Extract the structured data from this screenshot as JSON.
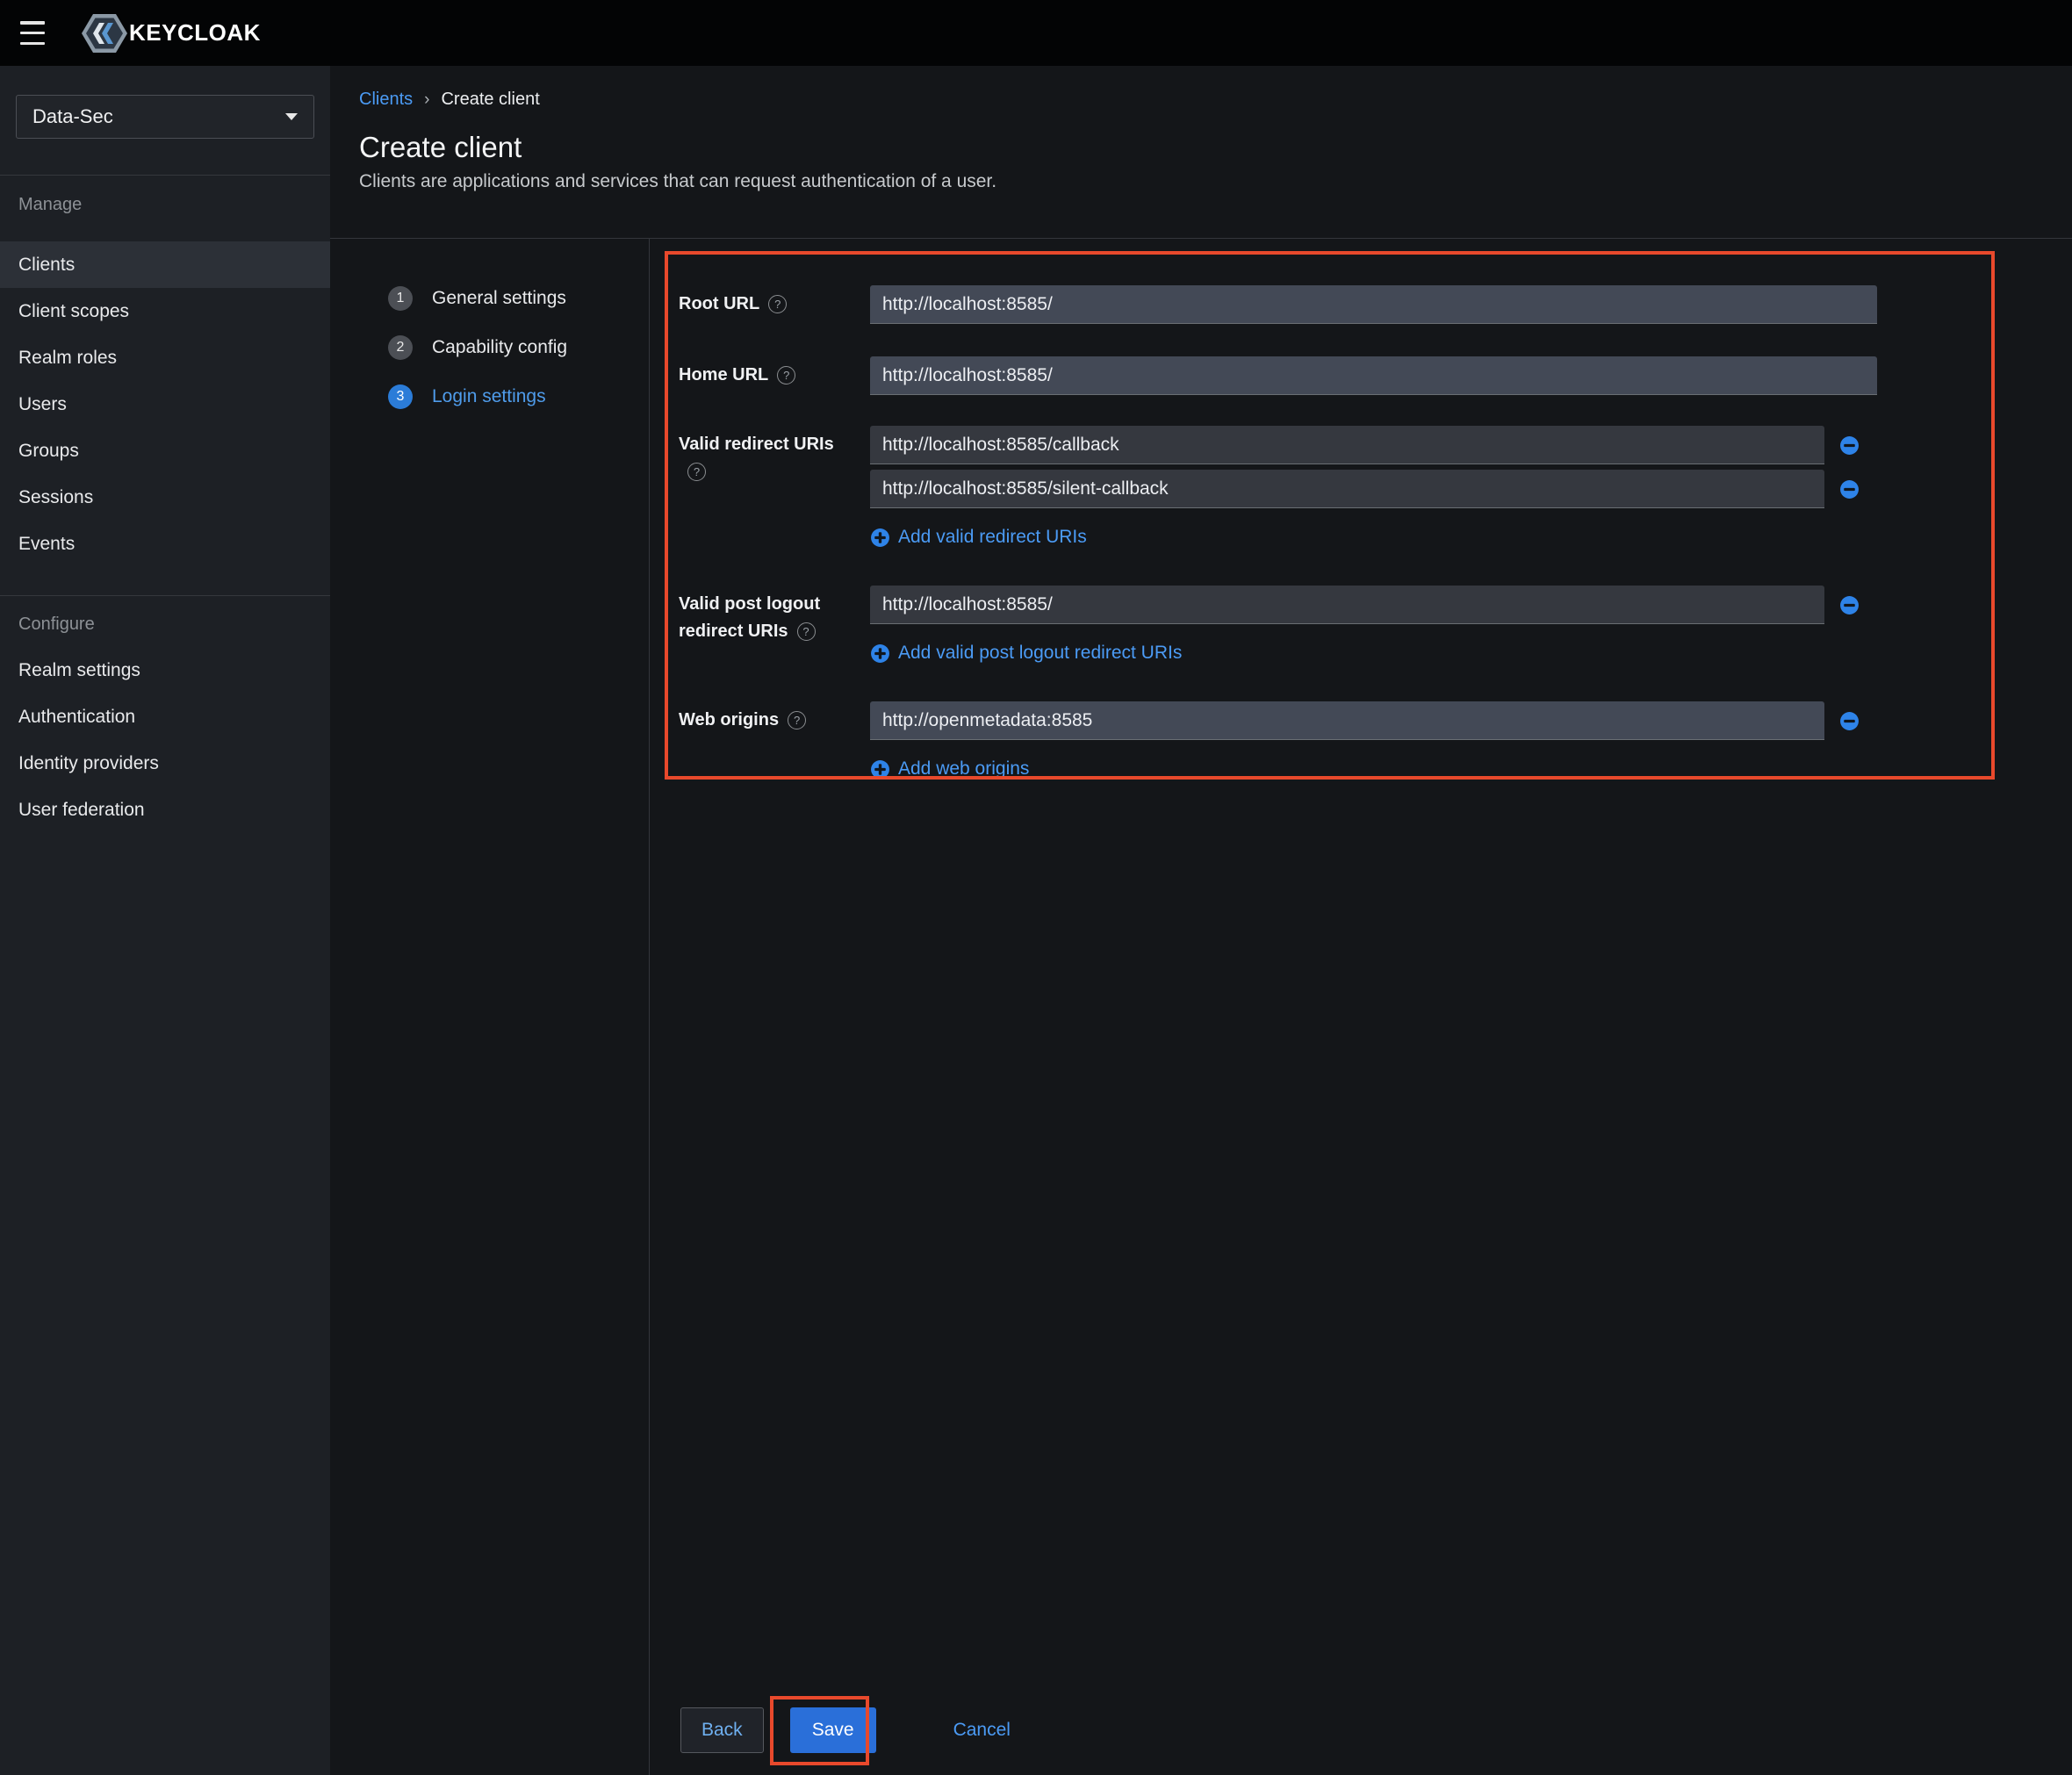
{
  "topbar": {
    "brand": "KEYCLOAK"
  },
  "icons": {
    "help": "?",
    "breadcrumb_separator": "›"
  },
  "sidebar": {
    "realm_selector": {
      "value": "Data-Sec"
    },
    "sections": [
      {
        "label": "Manage",
        "items": [
          {
            "label": "Clients"
          },
          {
            "label": "Client scopes"
          },
          {
            "label": "Realm roles"
          },
          {
            "label": "Users"
          },
          {
            "label": "Groups"
          },
          {
            "label": "Sessions"
          },
          {
            "label": "Events"
          }
        ]
      },
      {
        "label": "Configure",
        "items": [
          {
            "label": "Realm settings"
          },
          {
            "label": "Authentication"
          },
          {
            "label": "Identity providers"
          },
          {
            "label": "User federation"
          }
        ]
      }
    ]
  },
  "breadcrumb": {
    "items": [
      {
        "label": "Clients"
      },
      {
        "label": "Create client"
      }
    ]
  },
  "page": {
    "title": "Create client",
    "subtitle": "Clients are applications and services that can request authentication of a user."
  },
  "wizard": {
    "steps": [
      {
        "number": "1",
        "label": "General settings"
      },
      {
        "number": "2",
        "label": "Capability config"
      },
      {
        "number": "3",
        "label": "Login settings"
      }
    ]
  },
  "form": {
    "root_url": {
      "label": "Root URL",
      "value": "http://localhost:8585/"
    },
    "home_url": {
      "label": "Home URL",
      "value": "http://localhost:8585/"
    },
    "valid_redirect_uris": {
      "label": "Valid redirect URIs",
      "values": [
        "http://localhost:8585/callback",
        "http://localhost:8585/silent-callback"
      ],
      "add_label": "Add valid redirect URIs"
    },
    "valid_post_logout_redirect_uris": {
      "label": "Valid post logout redirect URIs",
      "values": [
        "http://localhost:8585/"
      ],
      "add_label": "Add valid post logout redirect URIs"
    },
    "web_origins": {
      "label": "Web origins",
      "values": [
        "http://openmetadata:8585"
      ],
      "add_label": "Add web origins"
    }
  },
  "actions": {
    "back": "Back",
    "save": "Save",
    "cancel": "Cancel"
  },
  "colors": {
    "annotation_red": "#e8492c",
    "link_blue": "#4b9bf5",
    "primary_button_blue": "#2a6fd9",
    "active_step_blue": "#2b7cd8"
  }
}
